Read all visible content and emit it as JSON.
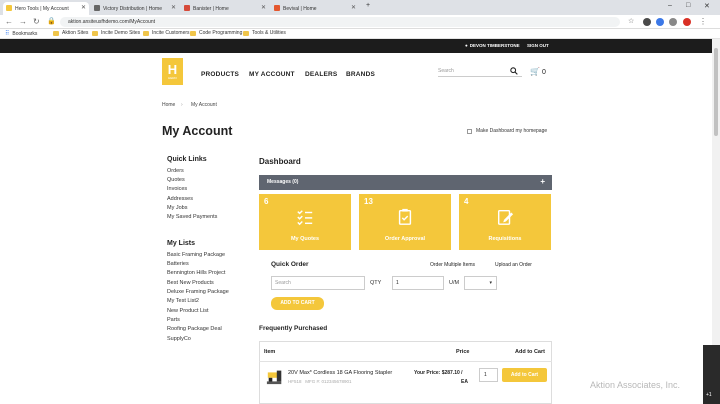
{
  "browser": {
    "tabs": [
      {
        "label": "Hero Tools | My Account",
        "color": "#f4c73b"
      },
      {
        "label": "Victory Distribution | Home",
        "color": "#666"
      },
      {
        "label": "Banister | Home",
        "color": "#d64a3a"
      },
      {
        "label": "Bevival | Home",
        "color": "#e4572e"
      }
    ],
    "new_tab": "+",
    "window_controls": [
      "–",
      "□",
      "✕"
    ],
    "url": "aktion.ansiteusfhdemo.com/MyAccount",
    "bookmarks": [
      "Bookmarks",
      "Aktion Sites",
      "Incite Demo Sites",
      "Incite Customers",
      "Code Programming",
      "Tools & Utilities"
    ]
  },
  "topbar": {
    "user": "DEVON TIMBERSTONE",
    "signout": "SIGN OUT"
  },
  "header": {
    "logo_letter": "H",
    "logo_sub": "HERO",
    "nav": [
      "PRODUCTS",
      "MY ACCOUNT",
      "DEALERS",
      "BRANDS"
    ],
    "search_placeholder": "Search",
    "cart_count": "0"
  },
  "breadcrumb": {
    "home": "Home",
    "sep": "›",
    "current": "My Account"
  },
  "page_title": "My Account",
  "homepage_label": "Make Dashboard my homepage",
  "sidebar": {
    "quick_links_title": "Quick Links",
    "quick_links": [
      "Orders",
      "Quotes",
      "Invoices",
      "Addresses",
      "My Jobs",
      "My Saved Payments"
    ],
    "my_lists_title": "My Lists",
    "my_lists": [
      "Basic Framing Package",
      "Batteries",
      "Bennington Hills Project",
      "Best New Products",
      "Deluxe Framing Package",
      "My Test List2",
      "New Product List",
      "Parts",
      "Roofing Package Deal",
      "SupplyCo"
    ]
  },
  "dashboard": {
    "title": "Dashboard",
    "messages_label": "Messages (0)",
    "messages_plus": "+",
    "tiles": [
      {
        "count": "6",
        "label": "My Quotes",
        "icon": "checklist-icon"
      },
      {
        "count": "13",
        "label": "Order Approval",
        "icon": "clipboard-check-icon"
      },
      {
        "count": "4",
        "label": "Requisitions",
        "icon": "edit-note-icon"
      }
    ]
  },
  "quick_order": {
    "title": "Quick Order",
    "order_multiple": "Order Multiple Items",
    "upload": "Upload an Order",
    "search_placeholder": "Search",
    "qty_label": "QTY",
    "qty_value": "1",
    "um_label": "U/M",
    "add_to_cart": "ADD TO CART"
  },
  "frequently_purchased": {
    "title": "Frequently Purchased",
    "columns": {
      "item": "Item",
      "price": "Price",
      "add": "Add to Cart"
    },
    "rows": [
      {
        "name": "20V Max* Cordless 18 GA Flooring Stapler",
        "sku": "HF518",
        "mfg": "MFG #: 012345678901",
        "price_label": "Your Price: $287.10 /",
        "unit": "EA",
        "qty": "1",
        "button": "Add to Cart"
      }
    ]
  },
  "watermark": "Aktion Associates, Inc.",
  "video_overlay": "+1",
  "colors": {
    "accent": "#f4c73b",
    "topbar": "#1c1c1c",
    "message_bar": "#5f6570"
  }
}
